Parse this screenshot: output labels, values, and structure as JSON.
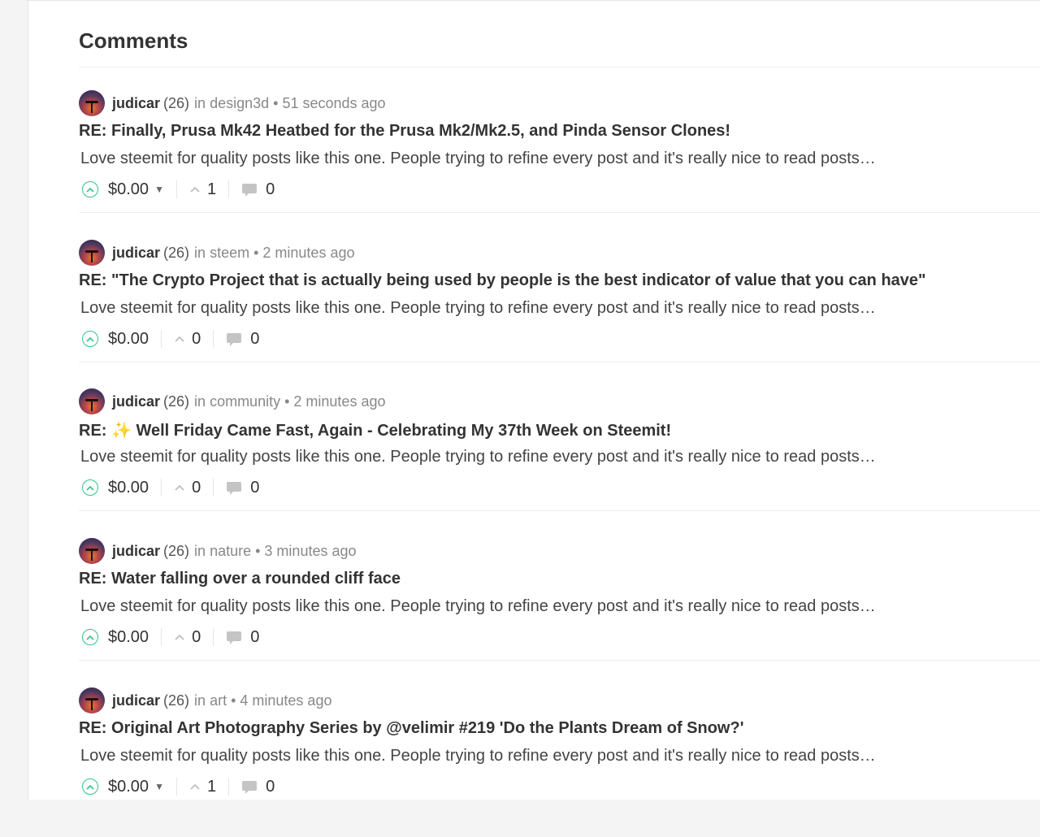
{
  "heading": "Comments",
  "comments": [
    {
      "author": "judicar",
      "reputation": "(26)",
      "in_label": "in",
      "community": "design3d",
      "dot": "•",
      "time": "51 seconds ago",
      "title": "RE: Finally, Prusa Mk42 Heatbed for the Prusa Mk2/Mk2.5, and Pinda Sensor Clones!",
      "body": "Love steemit for quality posts like this one. People trying to refine every post and it's really nice to read posts…",
      "payout": "$0.00",
      "has_payout_dropdown": true,
      "votes": "1",
      "replies": "0"
    },
    {
      "author": "judicar",
      "reputation": "(26)",
      "in_label": "in",
      "community": "steem",
      "dot": "•",
      "time": "2 minutes ago",
      "title": "RE: \"The Crypto Project that is actually being used by people is the best indicator of value that you can have\"",
      "body": "Love steemit for quality posts like this one. People trying to refine every post and it's really nice to read posts…",
      "payout": "$0.00",
      "has_payout_dropdown": false,
      "votes": "0",
      "replies": "0"
    },
    {
      "author": "judicar",
      "reputation": "(26)",
      "in_label": "in",
      "community": "community",
      "dot": "•",
      "time": "2 minutes ago",
      "title": "RE: ✨ Well Friday Came Fast, Again - Celebrating My 37th Week on Steemit!",
      "body": "Love steemit for quality posts like this one. People trying to refine every post and it's really nice to read posts…",
      "payout": "$0.00",
      "has_payout_dropdown": false,
      "votes": "0",
      "replies": "0"
    },
    {
      "author": "judicar",
      "reputation": "(26)",
      "in_label": "in",
      "community": "nature",
      "dot": "•",
      "time": "3 minutes ago",
      "title": "RE: Water falling over a rounded cliff face",
      "body": "Love steemit for quality posts like this one. People trying to refine every post and it's really nice to read posts…",
      "payout": "$0.00",
      "has_payout_dropdown": false,
      "votes": "0",
      "replies": "0"
    },
    {
      "author": "judicar",
      "reputation": "(26)",
      "in_label": "in",
      "community": "art",
      "dot": "•",
      "time": "4 minutes ago",
      "title": "RE: Original Art Photography Series by @velimir #219 'Do the Plants Dream of Snow?'",
      "body": "Love steemit for quality posts like this one. People trying to refine every post and it's really nice to read posts…",
      "payout": "$0.00",
      "has_payout_dropdown": true,
      "votes": "1",
      "replies": "0"
    }
  ],
  "icons": {
    "upvote": "upvote-circle-icon",
    "voters": "chevron-up-icon",
    "replies": "comment-bubble-icon",
    "payout_dropdown": "caret-down-icon"
  },
  "colors": {
    "upvote_accent": "#30c48b",
    "text": "#333333",
    "muted": "#888888"
  }
}
